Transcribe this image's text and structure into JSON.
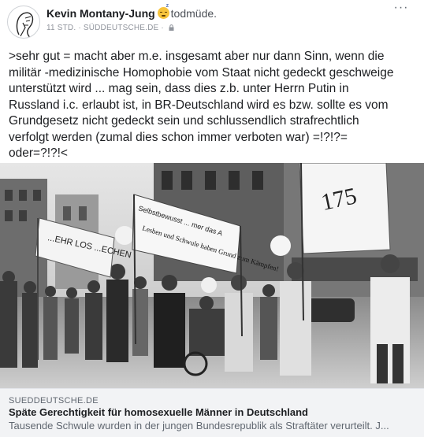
{
  "post": {
    "author": "Kevin Montany-Jung",
    "feeling_emoji": "sleepy-face-icon",
    "feeling": "todmüde.",
    "timestamp": "11 STD.",
    "separator": "·",
    "domain": "SÜDDEUTSCHE.DE",
    "separator2": "·",
    "privacy_icon": "lock-icon",
    "more_icon": "more-options-icon",
    "more_label": "···",
    "text": ">sehr gut = macht aber m.e. insgesamt aber nur dann Sinn, wenn die\nmilitär -medizinische  Homophobie vom Staat nicht gedeckt geschweige\nunterstützt wird ... mag sein, dass dies z.b. unter   Herrn Putin in\nRussland i.c.  erlaubt ist, in BR-Deutschland wird es bzw. sollte es vom\nGrundgesetz nicht gedeckt  sein und schlussendlich strafrechtlich\nverfolgt werden (zumal dies schon immer verboten war) =!?!?=\noder=?!?!<"
  },
  "link_preview": {
    "banner_left": "...EHR LOS ...ECHEN",
    "banner_center_top": "Selbstbewusst ... mer das A",
    "banner_center_main": "Lesben und Schwule haben Grund zum Kämpfen!",
    "banner_right": "175",
    "source": "SUEDDEUTSCHE.DE",
    "title": "Späte Gerechtigkeit für homosexuelle Männer in Deutschland",
    "description": "Tausende Schwule wurden in der jungen Bundesrepublik als Straftäter verurteilt. J..."
  }
}
